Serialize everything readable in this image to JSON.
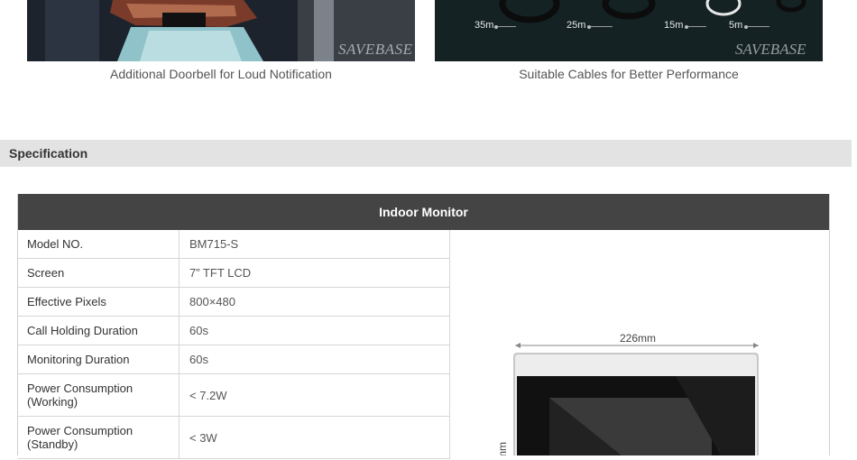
{
  "gallery": {
    "left_caption": "Additional Doorbell for Loud Notification",
    "right_caption": "Suitable Cables for Better Performance",
    "watermark": "SAVEBASE",
    "cable_lengths": [
      "35m",
      "25m",
      "15m",
      "5m"
    ]
  },
  "section": {
    "title": "Specification"
  },
  "table": {
    "header": "Indoor Monitor",
    "rows": [
      {
        "label": "Model NO.",
        "value": "BM715-S"
      },
      {
        "label": "Screen",
        "value": "7” TFT LCD"
      },
      {
        "label": "Effective Pixels",
        "value": "800×480"
      },
      {
        "label": "Call Holding Duration",
        "value": "60s"
      },
      {
        "label": "Monitoring Duration",
        "value": "60s"
      },
      {
        "label": "Power Consumption (Working)",
        "value": "< 7.2W"
      },
      {
        "label": "Power Consumption (Standby)",
        "value": "< 3W"
      }
    ],
    "product_image": {
      "width_dimension": "226mm",
      "height_dimension_fragment": "mm"
    }
  },
  "colors": {
    "table_header_bg": "#444444",
    "section_bar_bg": "#e3e3e3"
  }
}
